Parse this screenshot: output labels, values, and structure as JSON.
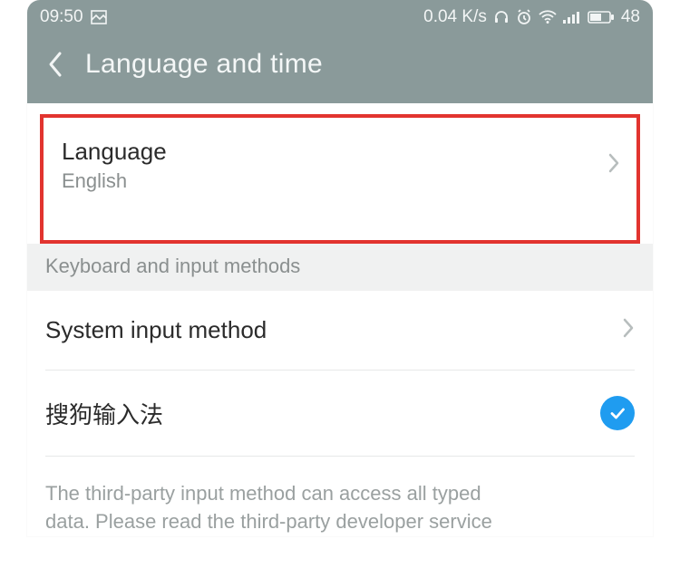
{
  "statusbar": {
    "time": "09:50",
    "speed": "0.04 K/s",
    "battery": "48"
  },
  "header": {
    "title": "Language and time"
  },
  "language_row": {
    "title": "Language",
    "value": "English"
  },
  "section": {
    "keyboard_heading": "Keyboard and input methods"
  },
  "sys_input_row": {
    "title": "System input method"
  },
  "ime_row": {
    "title": "搜狗输入法",
    "checked": true
  },
  "footer": {
    "line1": "The third-party input method can access all typed",
    "line2_partial": "data. Please read the third-party developer service"
  }
}
